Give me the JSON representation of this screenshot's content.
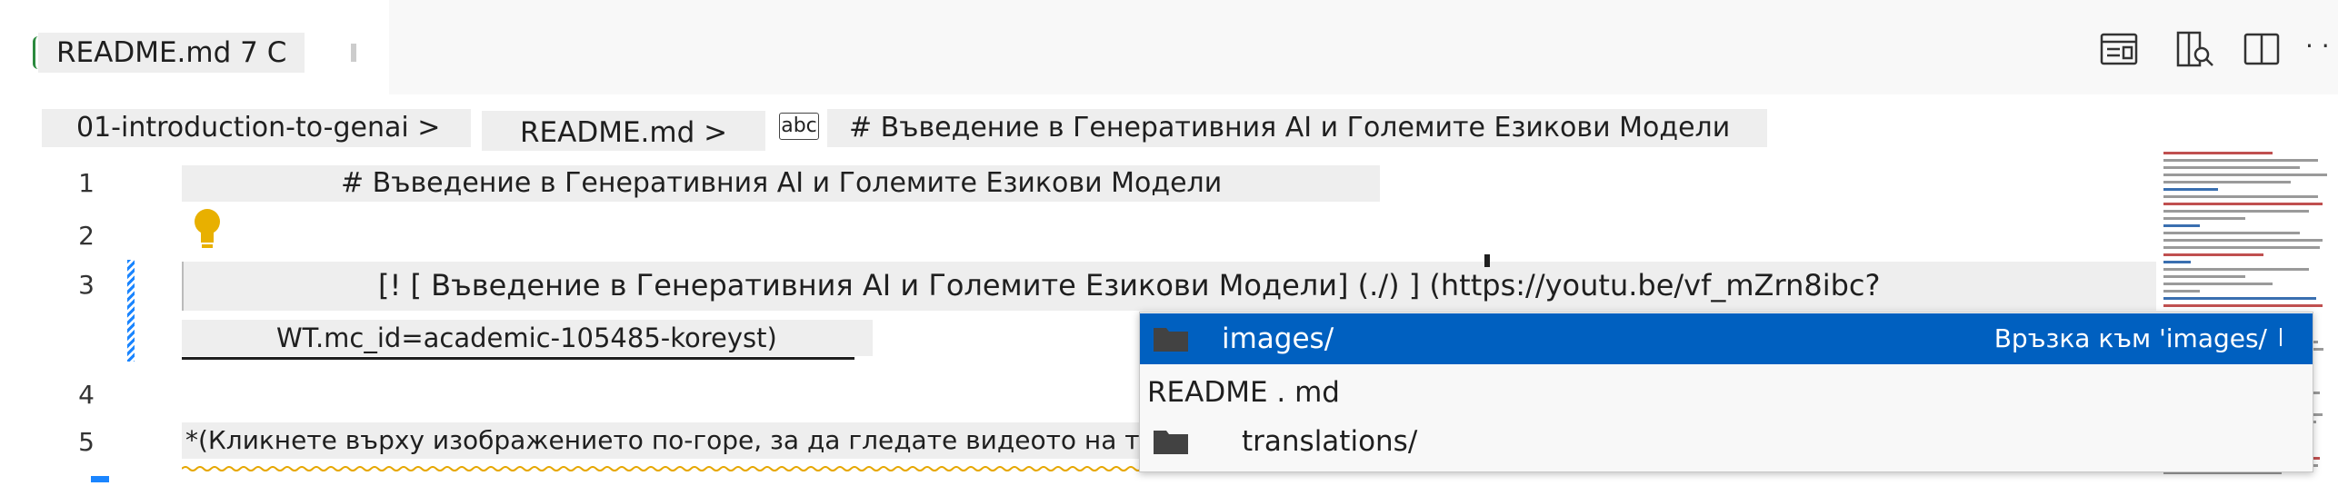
{
  "tabs": [
    {
      "label": "README.md 7 C",
      "active": true
    }
  ],
  "toolbar": {
    "icons": [
      "open-preview-icon",
      "show-source-preview-icon",
      "split-editor-icon",
      "more-actions-icon"
    ],
    "more_label": "· ·"
  },
  "breadcrumb": {
    "folder": "01-introduction-to-genai >",
    "file": "README.md >",
    "symbol_icon_label": "abc",
    "symbol": "# Въведение в Генеративния AI и Големите Езикови Модели"
  },
  "editor": {
    "lines": [
      {
        "number": "1",
        "text": "# Въведение в Генеративния AI и Големите Езикови Модели"
      },
      {
        "number": "2",
        "text": ""
      },
      {
        "number": "3",
        "text": "[! [ Въведение в Генеративния AI и Големите Езикови Модели] (./) ] (https://youtu.be/vf_mZrn8ibc?"
      },
      {
        "number": "",
        "text": "WT.mc_id=academic-105485-koreyst)"
      },
      {
        "number": "4",
        "text": ""
      },
      {
        "number": "5",
        "text": "*(Кликнете върху изображението по-горе, за да гледате видеото на това"
      }
    ]
  },
  "suggestions": {
    "items": [
      {
        "label": "images/",
        "detail": "Връзка към 'images/",
        "icon": "folder-icon",
        "selected": true
      },
      {
        "label": "README . md",
        "detail": "",
        "icon": "",
        "selected": false
      },
      {
        "label": "translations/",
        "detail": "",
        "icon": "folder-icon",
        "selected": false
      }
    ]
  },
  "colors": {
    "selection": "#0060c0",
    "lightbulb": "#e8b000",
    "squiggle": "#e6a700",
    "modified_gutter": "#1a85ff"
  }
}
